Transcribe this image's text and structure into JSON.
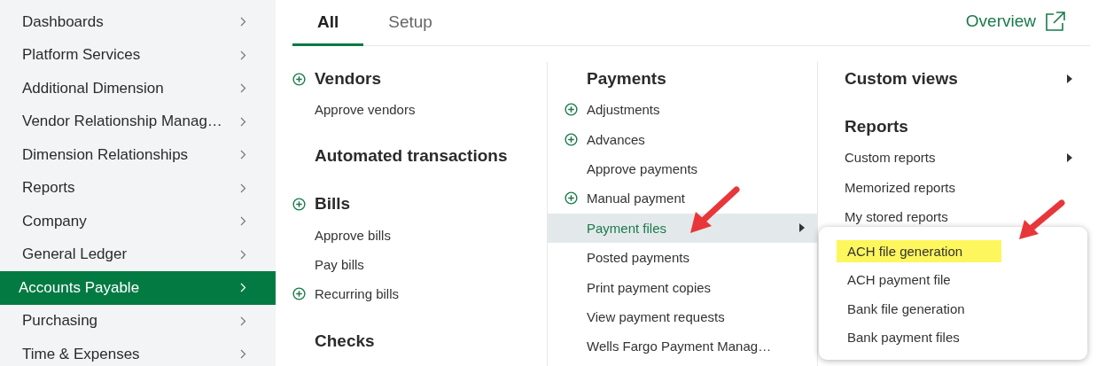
{
  "sidebar": {
    "items": [
      {
        "label": "Dashboards",
        "selected": false
      },
      {
        "label": "Platform Services",
        "selected": false
      },
      {
        "label": "Additional Dimension",
        "selected": false
      },
      {
        "label": "Vendor Relationship Manag…",
        "selected": false
      },
      {
        "label": "Dimension Relationships",
        "selected": false
      },
      {
        "label": "Reports",
        "selected": false
      },
      {
        "label": "Company",
        "selected": false
      },
      {
        "label": "General Ledger",
        "selected": false
      },
      {
        "label": "Accounts Payable",
        "selected": true
      },
      {
        "label": "Purchasing",
        "selected": false
      },
      {
        "label": "Time & Expenses",
        "selected": false
      }
    ]
  },
  "tabs": [
    {
      "label": "All",
      "selected": true
    },
    {
      "label": "Setup",
      "selected": false
    }
  ],
  "overview_link": {
    "label": "Overview"
  },
  "columns": [
    {
      "items": [
        {
          "kind": "heading",
          "label": "Vendors",
          "add": true
        },
        {
          "kind": "link",
          "label": "Approve vendors",
          "add": false
        },
        {
          "kind": "heading",
          "label": "Automated transactions",
          "add": false
        },
        {
          "kind": "heading",
          "label": "Bills",
          "add": true
        },
        {
          "kind": "link",
          "label": "Approve bills",
          "add": false
        },
        {
          "kind": "link",
          "label": "Pay bills",
          "add": false
        },
        {
          "kind": "link",
          "label": "Recurring bills",
          "add": true
        },
        {
          "kind": "heading",
          "label": "Checks",
          "add": false
        }
      ]
    },
    {
      "items": [
        {
          "kind": "heading",
          "label": "Payments",
          "add": false
        },
        {
          "kind": "link",
          "label": "Adjustments",
          "add": true
        },
        {
          "kind": "link",
          "label": "Advances",
          "add": true
        },
        {
          "kind": "link",
          "label": "Approve payments",
          "add": false
        },
        {
          "kind": "link",
          "label": "Manual payment",
          "add": true
        },
        {
          "kind": "link",
          "label": "Payment files",
          "add": false,
          "submenu": true,
          "selected": true
        },
        {
          "kind": "link",
          "label": "Posted payments",
          "add": false
        },
        {
          "kind": "link",
          "label": "Print payment copies",
          "add": false
        },
        {
          "kind": "link",
          "label": "View payment requests",
          "add": false
        },
        {
          "kind": "link",
          "label": "Wells Fargo Payment Manag…",
          "add": false
        }
      ]
    },
    {
      "items": [
        {
          "kind": "heading",
          "label": "Custom views",
          "add": false,
          "submenu": true
        },
        {
          "kind": "heading",
          "label": "Reports",
          "add": false
        },
        {
          "kind": "link",
          "label": "Custom reports",
          "add": false,
          "submenu": true
        },
        {
          "kind": "link",
          "label": "Memorized reports",
          "add": false
        },
        {
          "kind": "link",
          "label": "My stored reports",
          "add": false
        }
      ]
    }
  ],
  "submenu": {
    "items": [
      {
        "label": "ACH file generation",
        "highlighted": true
      },
      {
        "label": "ACH payment file",
        "highlighted": false
      },
      {
        "label": "Bank file generation",
        "highlighted": false
      },
      {
        "label": "Bank payment files",
        "highlighted": false
      }
    ]
  }
}
